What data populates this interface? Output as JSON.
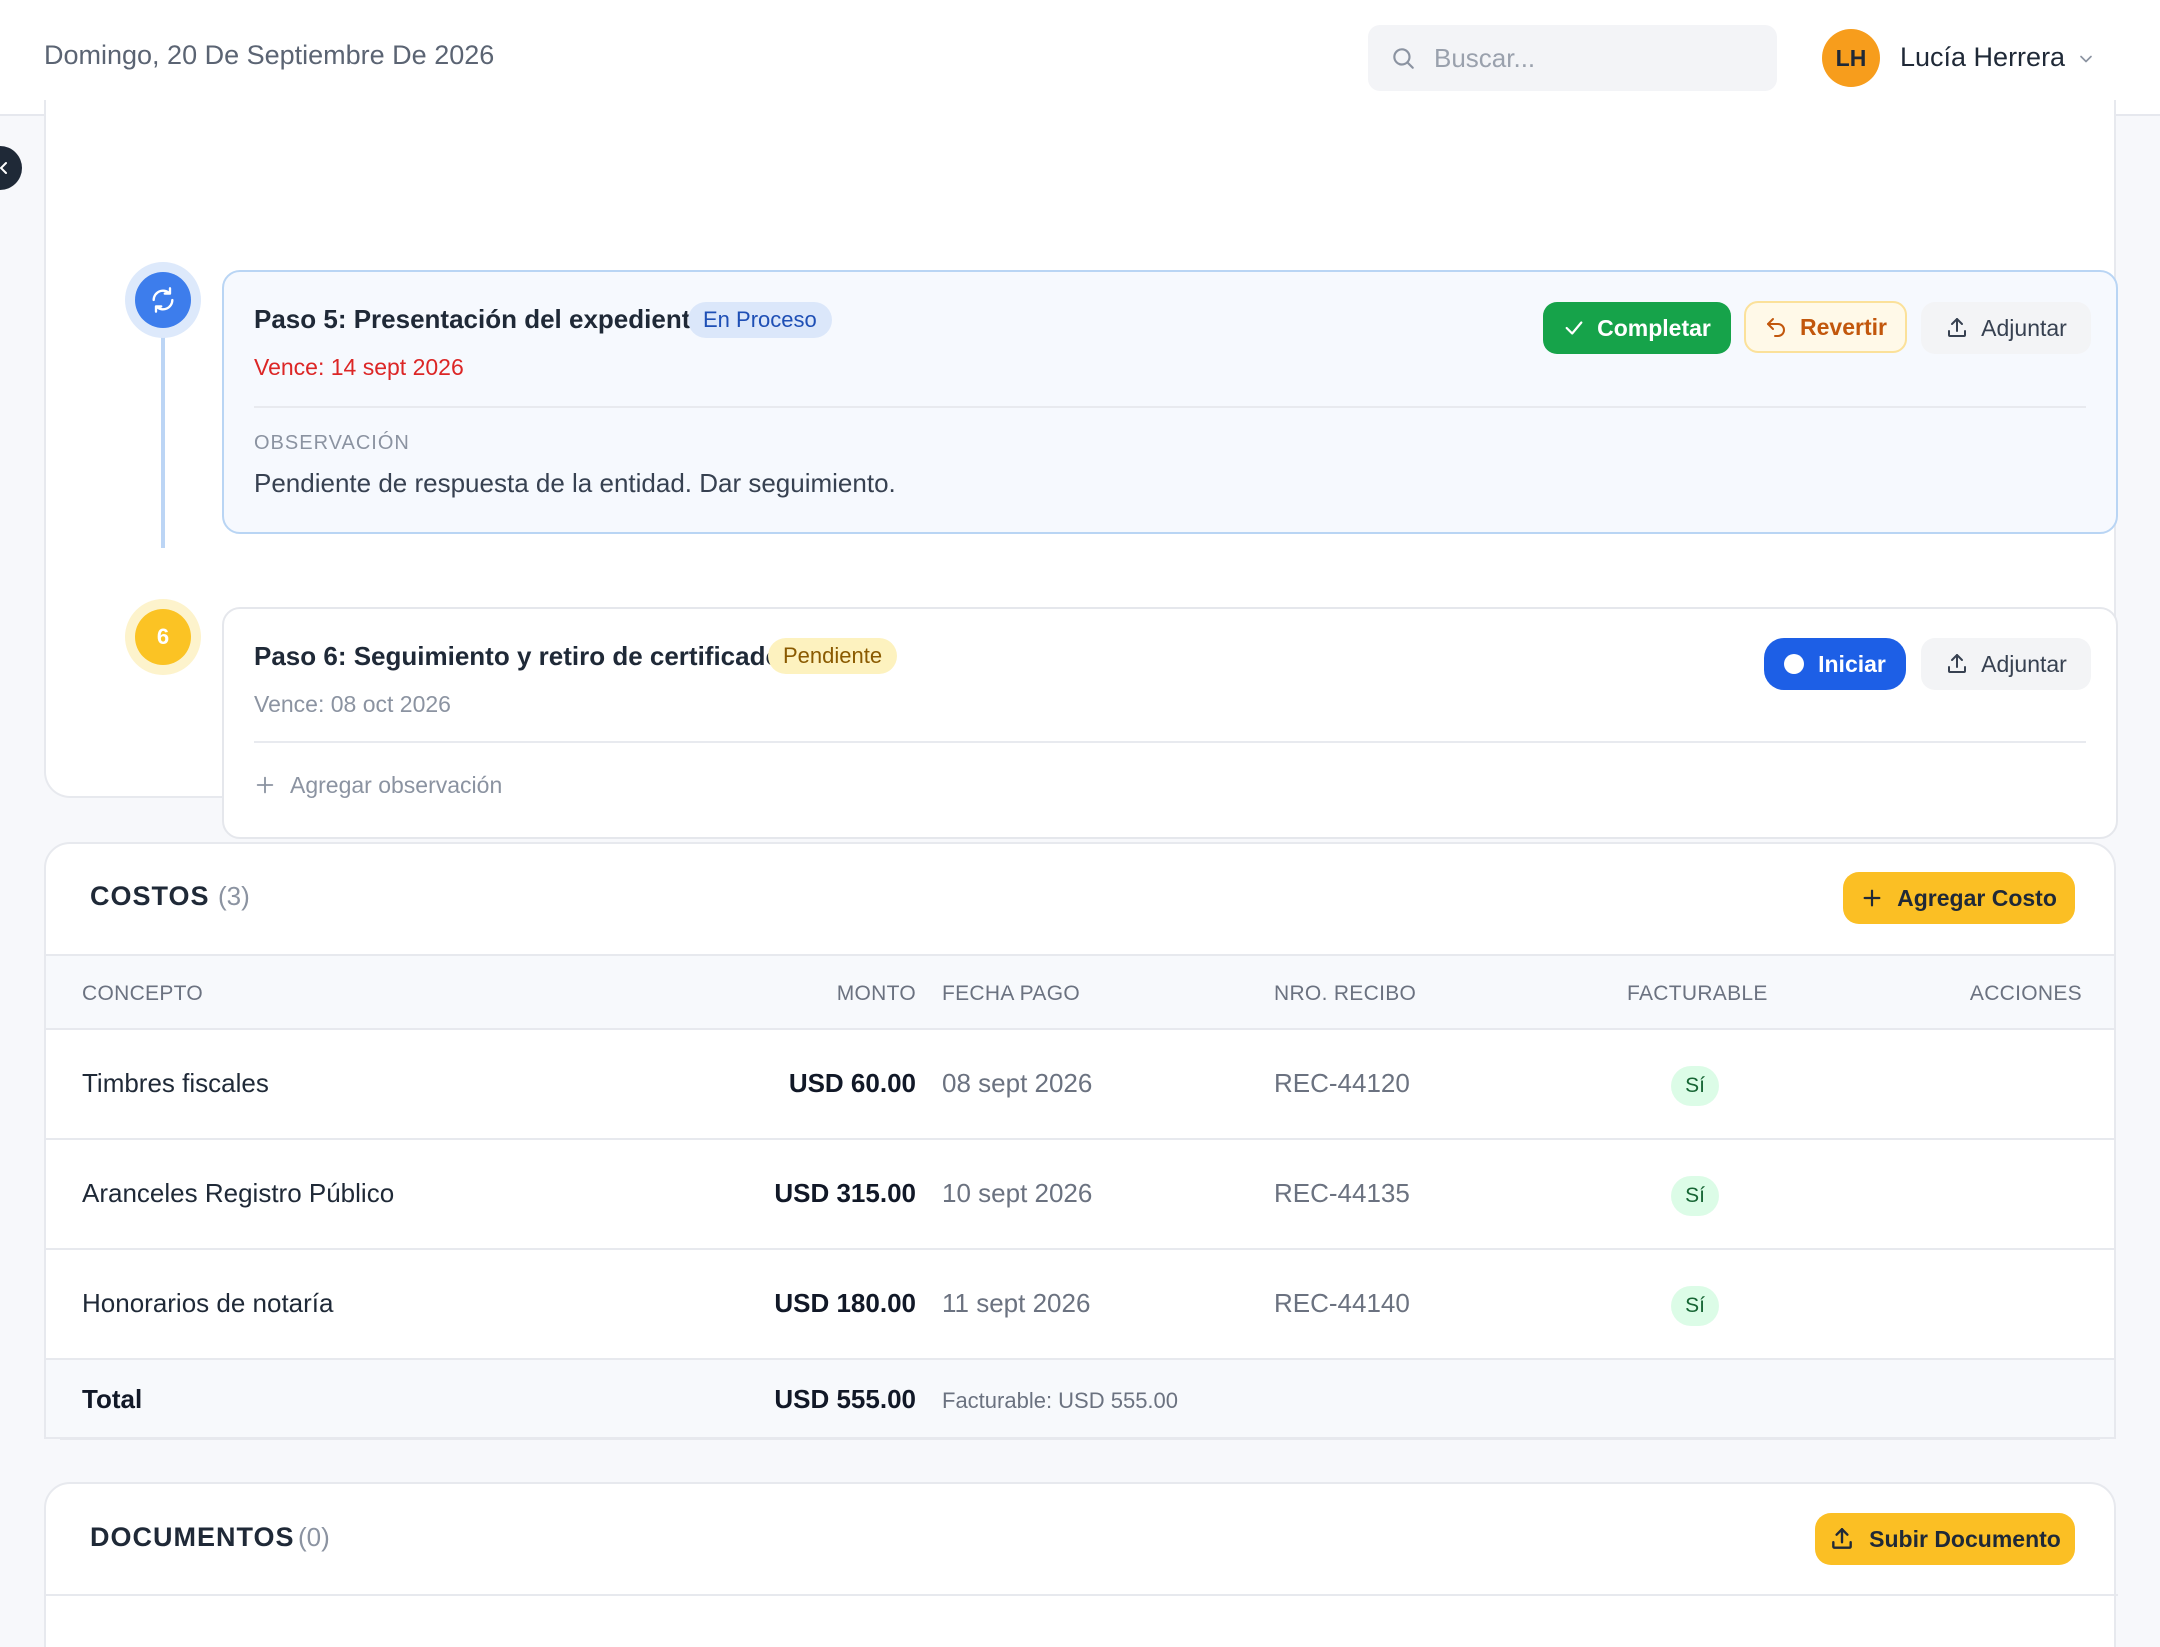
{
  "header": {
    "date": "Domingo, 20 De Septiembre De 2026",
    "search_placeholder": "Buscar...",
    "user": {
      "initials": "LH",
      "name": "Lucía Herrera",
      "avatar_color": "#f79d1c"
    }
  },
  "steps": [
    {
      "title": "Paso 5: Presentación del expediente",
      "status": "En Proceso",
      "due": "Vence: 14 sept 2026",
      "observation_label": "OBSERVACIÓN",
      "observation": "Pendiente de respuesta de la entidad. Dar seguimiento.",
      "actions": {
        "complete": "Completar",
        "revert": "Revertir",
        "attach": "Adjuntar"
      }
    },
    {
      "marker": "6",
      "title": "Paso 6: Seguimiento y retiro de certificado",
      "status": "Pendiente",
      "due": "Vence: 08 oct 2026",
      "add_observation": "Agregar observación",
      "actions": {
        "start": "Iniciar",
        "attach": "Adjuntar"
      }
    }
  ],
  "costs": {
    "title": "COSTOS",
    "count": "(3)",
    "add_button": "Agregar Costo",
    "columns": [
      "CONCEPTO",
      "MONTO",
      "FECHA PAGO",
      "NRO. RECIBO",
      "FACTURABLE",
      "ACCIONES"
    ],
    "rows": [
      {
        "concept": "Timbres fiscales",
        "amount": "USD 60.00",
        "date": "08 sept 2026",
        "receipt": "REC-44120",
        "billable": "Sí"
      },
      {
        "concept": "Aranceles Registro Público",
        "amount": "USD 315.00",
        "date": "10 sept 2026",
        "receipt": "REC-44135",
        "billable": "Sí"
      },
      {
        "concept": "Honorarios de notaría",
        "amount": "USD 180.00",
        "date": "11 sept 2026",
        "receipt": "REC-44140",
        "billable": "Sí"
      }
    ],
    "total_label": "Total",
    "total_amount": "USD 555.00",
    "total_billable": "Facturable: USD 555.00"
  },
  "documents": {
    "title": "DOCUMENTOS",
    "count": "(0)",
    "upload_button": "Subir Documento"
  },
  "colors": {
    "success": "#16a34a",
    "primary": "#1d5fe6",
    "warning": "#fbbf24",
    "danger": "#dc2626"
  }
}
